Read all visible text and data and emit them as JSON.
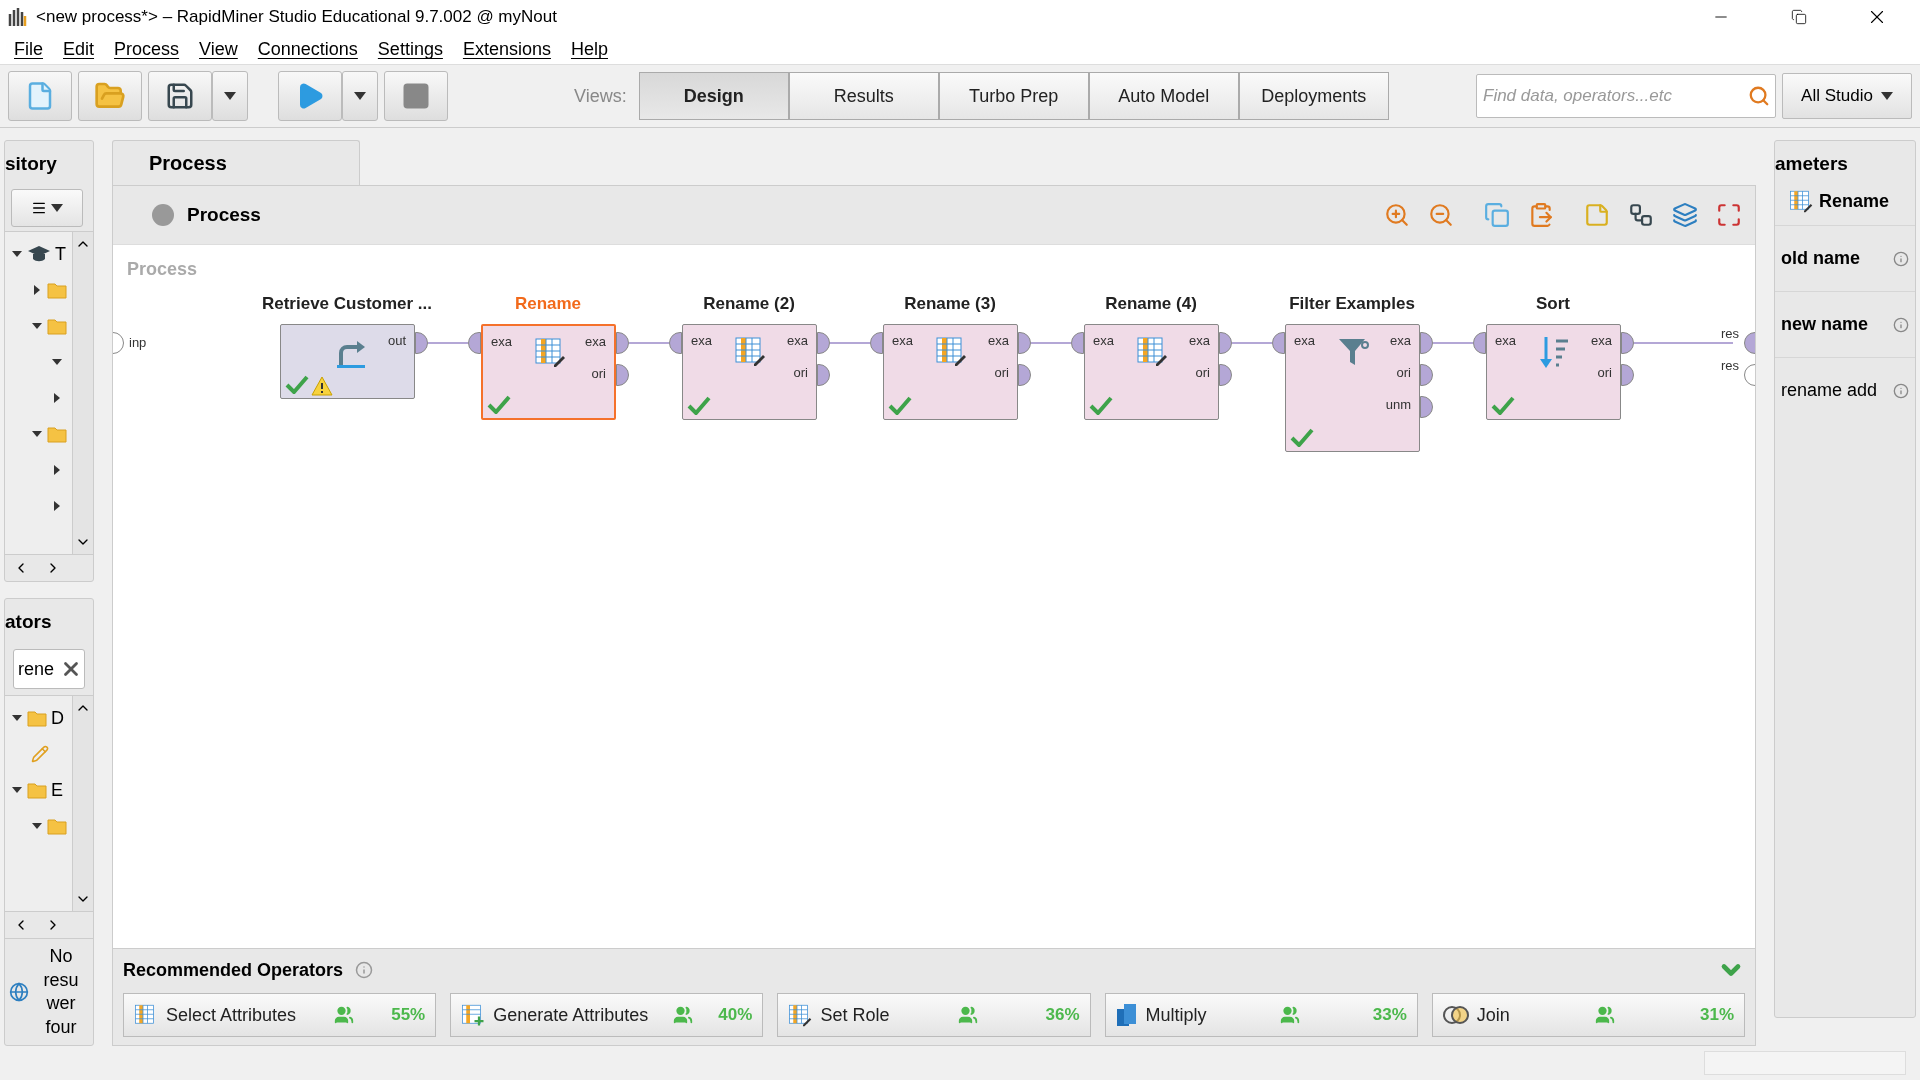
{
  "window": {
    "title": "<new process*> – RapidMiner Studio Educational 9.7.002 @ myNout"
  },
  "menu": [
    "File",
    "Edit",
    "Process",
    "View",
    "Connections",
    "Settings",
    "Extensions",
    "Help"
  ],
  "toolbar": {
    "stop_disabled": true,
    "views_label": "Views:",
    "views": [
      {
        "label": "Design",
        "selected": true
      },
      {
        "label": "Results",
        "selected": false
      },
      {
        "label": "Turbo Prep",
        "selected": false
      },
      {
        "label": "Auto Model",
        "selected": false
      },
      {
        "label": "Deployments",
        "selected": false
      }
    ],
    "search": {
      "placeholder": "Find data, operators...etc"
    },
    "scope": "All Studio"
  },
  "repository": {
    "title": "sitory",
    "tree": [
      {
        "label": "T",
        "kind": "root",
        "expanded": true,
        "children": [
          {
            "kind": "folder",
            "expanded": false
          },
          {
            "kind": "folder",
            "expanded": true,
            "children": [
              {
                "expanded": true
              },
              {
                "expanded": false
              }
            ]
          },
          {
            "kind": "folder",
            "expanded": true,
            "children": [
              {
                "expanded": false
              },
              {
                "expanded": false
              }
            ]
          }
        ]
      }
    ]
  },
  "operators": {
    "title": "ators",
    "search": "rene",
    "tree": [
      {
        "label": "D",
        "kind": "folder",
        "expanded": true,
        "children": [
          {
            "kind": "pencil"
          }
        ]
      },
      {
        "label": "E",
        "kind": "folder",
        "expanded": true,
        "children": [
          {
            "kind": "folder",
            "expanded": true
          }
        ]
      }
    ],
    "message": [
      "No",
      "resu",
      "wer",
      "four"
    ]
  },
  "process": {
    "tab": "Process",
    "breadcrumb": "Process",
    "canvas_label": "Process",
    "input_ports": [
      {
        "label": "inp",
        "connected": false
      }
    ],
    "output_ports": [
      {
        "label": "res",
        "connected": true
      },
      {
        "label": "res",
        "connected": false
      }
    ],
    "nodes": [
      {
        "name": "Retrieve Customer ...",
        "kind": "retrieve",
        "selected": false,
        "warning": true,
        "outputs": [
          "out"
        ]
      },
      {
        "name": "Rename",
        "kind": "rename",
        "selected": true,
        "warning": false,
        "inputs": [
          "exa"
        ],
        "outputs": [
          "exa",
          "ori"
        ]
      },
      {
        "name": "Rename (2)",
        "kind": "rename",
        "selected": false,
        "warning": false,
        "inputs": [
          "exa"
        ],
        "outputs": [
          "exa",
          "ori"
        ]
      },
      {
        "name": "Rename (3)",
        "kind": "rename",
        "selected": false,
        "warning": false,
        "inputs": [
          "exa"
        ],
        "outputs": [
          "exa",
          "ori"
        ]
      },
      {
        "name": "Rename (4)",
        "kind": "rename",
        "selected": false,
        "warning": false,
        "inputs": [
          "exa"
        ],
        "outputs": [
          "exa",
          "ori"
        ]
      },
      {
        "name": "Filter Examples",
        "kind": "filter",
        "selected": false,
        "warning": false,
        "inputs": [
          "exa"
        ],
        "outputs": [
          "exa",
          "ori",
          "unm"
        ]
      },
      {
        "name": "Sort",
        "kind": "sort",
        "selected": false,
        "warning": false,
        "inputs": [
          "exa"
        ],
        "outputs": [
          "exa",
          "ori"
        ]
      }
    ]
  },
  "recommended": {
    "title": "Recommended Operators",
    "items": [
      {
        "label": "Select Attributes",
        "share": "55%",
        "kind": "select"
      },
      {
        "label": "Generate Attributes",
        "share": "40%",
        "kind": "generate"
      },
      {
        "label": "Set Role",
        "share": "36%",
        "kind": "role"
      },
      {
        "label": "Multiply",
        "share": "33%",
        "kind": "multiply"
      },
      {
        "label": "Join",
        "share": "31%",
        "kind": "join"
      }
    ]
  },
  "parameters": {
    "title": "ameters",
    "operator": "Rename",
    "items": [
      {
        "label": "old name",
        "required": true
      },
      {
        "label": "new name",
        "required": true
      },
      {
        "label": "rename add",
        "required": false
      }
    ]
  }
}
